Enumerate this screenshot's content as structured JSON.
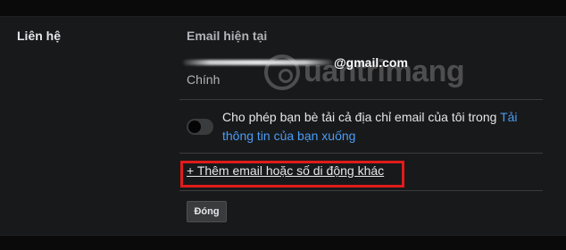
{
  "section": {
    "label": "Liên hệ"
  },
  "email": {
    "heading": "Email hiện tại",
    "address_visible_part": "@gmail.com",
    "type": "Chính"
  },
  "sharing": {
    "text": "Cho phép bạn bè tải cả địa chỉ email của tôi trong ",
    "link": "Tải thông tin của bạn xuống",
    "toggle_on": false
  },
  "actions": {
    "add_contact": "+ Thêm email hoặc số di động khác",
    "close": "Đóng"
  },
  "watermark": {
    "text": "uantrimang"
  },
  "colors": {
    "panel_bg": "#18191a",
    "highlight": "#e01b1b",
    "link": "#4a9cf5"
  }
}
